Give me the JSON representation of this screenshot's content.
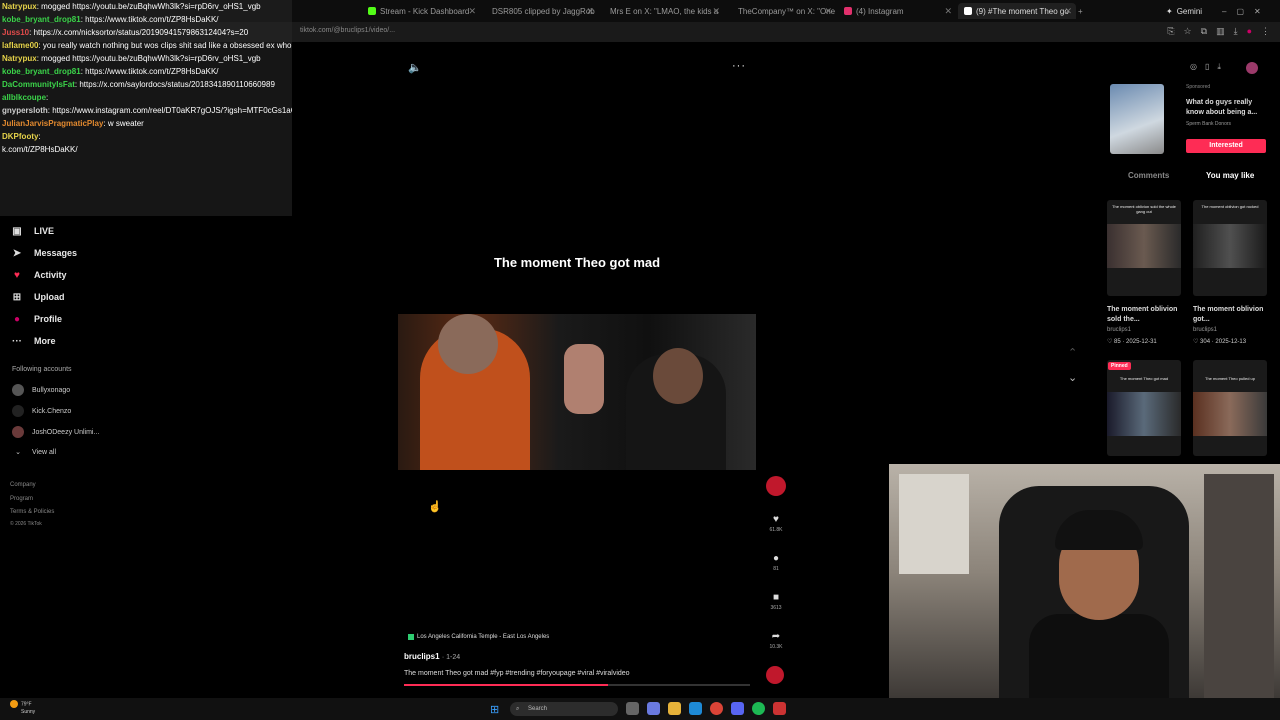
{
  "browser": {
    "tabs": [
      {
        "label": "Stream - Kick Dashboard",
        "color": "#53fc18"
      },
      {
        "label": "DSR805 clipped by JaggRob",
        "color": "#53fc18"
      },
      {
        "label": "Mrs E on X: \"LMAO, the kids a",
        "color": "#ffffff"
      },
      {
        "label": "TheCompany™ on X: \"One of",
        "color": "#ffffff"
      },
      {
        "label": "(4) Instagram",
        "color": "#e1306c"
      },
      {
        "label": "(9) #The moment Theo go",
        "color": "#ffffff"
      }
    ],
    "url": "tiktok.com/@bruclips1/video/...",
    "profile_label": "Gemini"
  },
  "chat": [
    {
      "user": "Natrypux",
      "color": "#e6d34a",
      "msg": ": mogged https://youtu.be/zuBqhwWh3lk?si=rpD6rv_oHS1_vgb"
    },
    {
      "user": "kobe_bryant_drop81",
      "color": "#3bd44a",
      "msg": ": https://www.tiktok.com/t/ZP8HsDaKK/"
    },
    {
      "user": "Juss10",
      "color": "#e34b4b",
      "msg": ": https://x.com/nicksortor/status/2019094157986312404?s=20"
    },
    {
      "user": "laflame00",
      "color": "#e6d34a",
      "msg": ": you really watch nothing but wos clips shit sad like a obsessed ex who can't move on lmao"
    },
    {
      "user": "Natrypux",
      "color": "#e6d34a",
      "msg": ": mogged https://youtu.be/zuBqhwWh3lk?si=rpD6rv_oHS1_vgb"
    },
    {
      "user": "kobe_bryant_drop81",
      "color": "#3bd44a",
      "msg": ": https://www.tiktok.com/t/ZP8HsDaKK/"
    },
    {
      "user": "DaCommunityIsFat",
      "color": "#3bd44a",
      "msg": ": https://x.com/saylordocs/status/2018341890110660989"
    },
    {
      "user": "allblkcoupe",
      "color": "#3bd44a",
      "msg": ":"
    },
    {
      "user": "gnypersloth",
      "color": "#cfcfcf",
      "msg": ": https://www.instagram.com/reel/DT0aKR7gOJS/?igsh=MTF0cGs1aGVjMThxeg=="
    },
    {
      "user": "JulianJarvisPragmaticPlay",
      "color": "#e38a2f",
      "msg": ": w sweater"
    },
    {
      "user": "DKPfooty",
      "color": "#e6d34a",
      "msg": ":"
    },
    {
      "user": "",
      "color": "#ffffff",
      "msg": "k.com/t/ZP8HsDaKK/"
    }
  ],
  "sidebar": {
    "items": [
      {
        "label": "LIVE",
        "icon": "live-icon"
      },
      {
        "label": "Messages",
        "icon": "messages-icon"
      },
      {
        "label": "Activity",
        "icon": "activity-icon"
      },
      {
        "label": "Upload",
        "icon": "upload-icon"
      },
      {
        "label": "Profile",
        "icon": "profile-icon"
      },
      {
        "label": "More",
        "icon": "more-icon"
      }
    ],
    "following_title": "Following accounts",
    "following": [
      "Bullyxonago",
      "Kick.Chenzo",
      "JoshODeezy Unlimi..."
    ],
    "view_all": "View all",
    "footer": [
      "Company",
      "Program",
      "Terms & Policies",
      "© 2026 TikTok"
    ]
  },
  "video": {
    "overlay_text": "The moment Theo got mad",
    "location": "Los Angeles California Temple - East Los Angeles",
    "author": "bruclips1",
    "date": "· 1-24",
    "caption": "The moment Theo got mad #fyp #trending #foryoupage #viral #viralvideo",
    "progress": 0.59,
    "likes": "61.8K",
    "comments": "81",
    "saves": "3613",
    "shares": "10.3K"
  },
  "right_panel": {
    "ad": {
      "sponsored": "Sponsored",
      "title": "What do guys really know about being a...",
      "sub": "Sperm Bank Donors",
      "button": "Interested"
    },
    "tabs": [
      "Comments",
      "You may like"
    ],
    "recommendations": [
      {
        "caption": "The moment oblivion sold the whole gang out",
        "title": "The moment oblivion sold the...",
        "author": "bruclips1",
        "stats": "♡ 85 · 2025-12-31"
      },
      {
        "caption": "The moment oblivion got rocked",
        "title": "The moment oblivion got...",
        "author": "bruclips1",
        "stats": "♡ 304 · 2025-12-13"
      },
      {
        "caption": "The moment Theo got mad",
        "title": "",
        "author": "",
        "stats": "",
        "pinned": "Pinned"
      },
      {
        "caption": "The moment Theo pulled up",
        "title": "",
        "author": "",
        "stats": ""
      }
    ]
  },
  "taskbar": {
    "weather_temp": "79°F",
    "weather_desc": "Sunny",
    "search_placeholder": "Search"
  }
}
